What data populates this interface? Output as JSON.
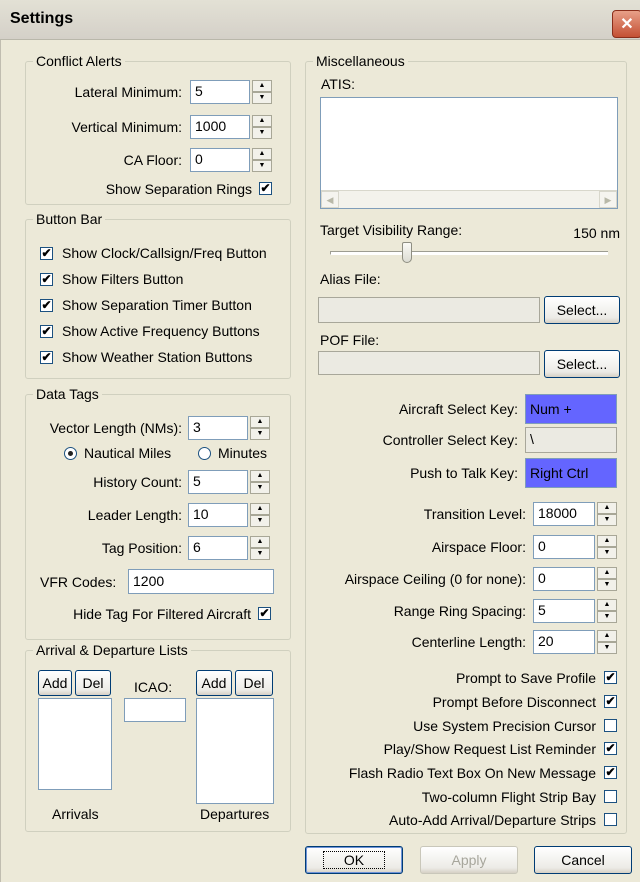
{
  "window": {
    "title": "Settings",
    "close_glyph": "✕"
  },
  "conflict_alerts": {
    "legend": "Conflict Alerts",
    "lateral_label": "Lateral Minimum:",
    "lateral_value": "5",
    "vertical_label": "Vertical Minimum:",
    "vertical_value": "1000",
    "ca_floor_label": "CA Floor:",
    "ca_floor_value": "0",
    "rings_label": "Show Separation Rings",
    "rings_checked": true
  },
  "button_bar": {
    "legend": "Button Bar",
    "items": [
      {
        "label": "Show Clock/Callsign/Freq Button",
        "checked": true
      },
      {
        "label": "Show Filters Button",
        "checked": true
      },
      {
        "label": "Show Separation Timer Button",
        "checked": true
      },
      {
        "label": "Show Active Frequency Buttons",
        "checked": true
      },
      {
        "label": "Show Weather Station Buttons",
        "checked": true
      }
    ]
  },
  "data_tags": {
    "legend": "Data Tags",
    "vector_label": "Vector Length (NMs):",
    "vector_value": "3",
    "nautical_label": "Nautical Miles",
    "minutes_label": "Minutes",
    "unit_selected": "nautical",
    "history_label": "History Count:",
    "history_value": "5",
    "leader_label": "Leader Length:",
    "leader_value": "10",
    "tagpos_label": "Tag Position:",
    "tagpos_value": "6",
    "vfr_label": "VFR Codes:",
    "vfr_value": "1200",
    "hide_label": "Hide Tag For Filtered Aircraft",
    "hide_checked": true
  },
  "lists": {
    "legend": "Arrival & Departure Lists",
    "add_label": "Add",
    "del_label": "Del",
    "icao_label": "ICAO:",
    "icao_value": "",
    "arrivals_label": "Arrivals",
    "departures_label": "Departures"
  },
  "misc": {
    "legend": "Miscellaneous",
    "atis_label": "ATIS:",
    "atis_value": "",
    "tvr_label": "Target Visibility Range:",
    "tvr_value": "150 nm",
    "tvr_fraction": 0.27,
    "alias_label": "Alias File:",
    "alias_value": "",
    "select_label": "Select...",
    "pof_label": "POF File:",
    "pof_value": "",
    "aircraft_key_label": "Aircraft Select Key:",
    "aircraft_key_value": "Num +",
    "controller_key_label": "Controller Select Key:",
    "controller_key_value": "\\",
    "ptt_key_label": "Push to Talk Key:",
    "ptt_key_value": "Right Ctrl",
    "transition_label": "Transition Level:",
    "transition_value": "18000",
    "floor_label": "Airspace Floor:",
    "floor_value": "0",
    "ceiling_label": "Airspace Ceiling (0 for none):",
    "ceiling_value": "0",
    "ring_spacing_label": "Range Ring Spacing:",
    "ring_spacing_value": "5",
    "centerline_label": "Centerline Length:",
    "centerline_value": "20",
    "options": [
      {
        "label": "Prompt to Save Profile",
        "checked": true
      },
      {
        "label": "Prompt Before Disconnect",
        "checked": true
      },
      {
        "label": "Use System Precision Cursor",
        "checked": false
      },
      {
        "label": "Play/Show Request List Reminder",
        "checked": true
      },
      {
        "label": "Flash Radio Text Box On New Message",
        "checked": true
      },
      {
        "label": "Two-column Flight Strip Bay",
        "checked": false
      },
      {
        "label": "Auto-Add Arrival/Departure Strips",
        "checked": false
      }
    ]
  },
  "footer": {
    "ok_label": "OK",
    "apply_label": "Apply",
    "cancel_label": "Cancel"
  },
  "colors": {
    "key_highlight": "#6465FF",
    "title_close": "#C45034"
  },
  "icons": {
    "spin_up": "▲",
    "spin_down": "▼",
    "check": "✔",
    "scroll_left": "◀",
    "scroll_right": "▶"
  }
}
